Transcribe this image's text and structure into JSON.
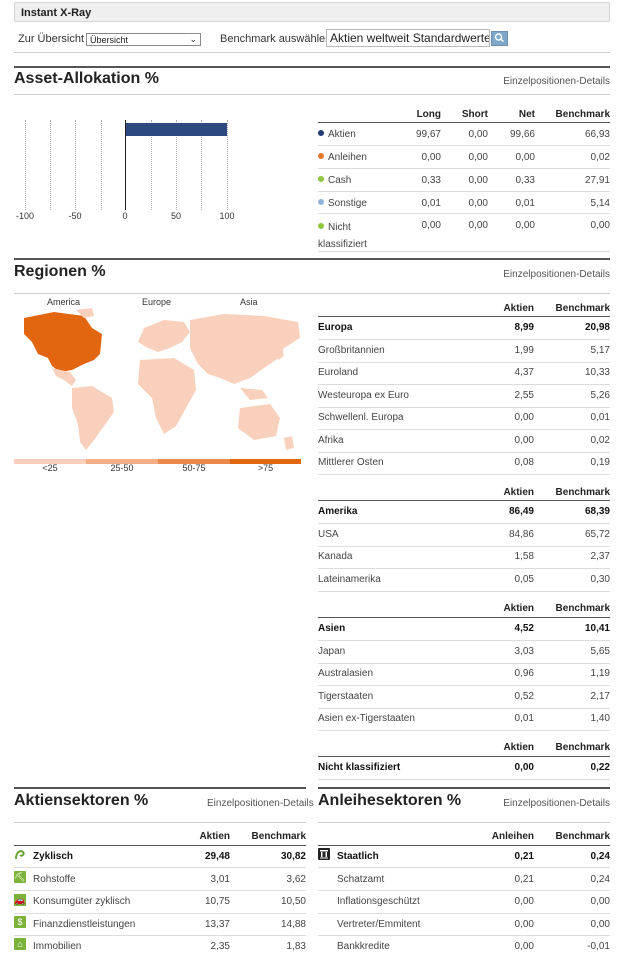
{
  "header": {
    "title": "Instant X-Ray",
    "overview_label": "Zur Übersicht",
    "overview_select": "Übersicht",
    "benchmark_label": "Benchmark auswählen",
    "benchmark_value": "Aktien weltweit Standardwerte"
  },
  "asset_allocation": {
    "title": "Asset-Allokation %",
    "details_link": "Einzelpositionen-Details",
    "headers": [
      "Long",
      "Short",
      "Net",
      "Benchmark"
    ],
    "rows": [
      {
        "label": "Aktien",
        "color": "#1f3b73",
        "long": "99,67",
        "short": "0,00",
        "net": "99,66",
        "benchmark": "66,93"
      },
      {
        "label": "Anleihen",
        "color": "#e8762b",
        "long": "0,00",
        "short": "0,00",
        "net": "0,00",
        "benchmark": "0,02"
      },
      {
        "label": "Cash",
        "color": "#8dc63f",
        "long": "0,33",
        "short": "0,00",
        "net": "0,33",
        "benchmark": "27,91"
      },
      {
        "label": "Sonstige",
        "color": "#8fb3d9",
        "long": "0,01",
        "short": "0,00",
        "net": "0,01",
        "benchmark": "5,14"
      },
      {
        "label_line1": "Nicht",
        "label_line2": "klassifiziert",
        "color": "#8dc63f",
        "long": "0,00",
        "short": "0,00",
        "net": "0,00",
        "benchmark": "0,00"
      }
    ]
  },
  "chart_data": {
    "type": "bar",
    "orientation": "horizontal",
    "categories": [
      "Aktien (Net)"
    ],
    "values": [
      99.66
    ],
    "xlim": [
      -100,
      100
    ],
    "ticks": [
      "-100",
      "-50",
      "0",
      "50",
      "100"
    ],
    "color": "#2d4a80",
    "grid": true
  },
  "regions": {
    "title": "Regionen %",
    "details_link": "Einzelpositionen-Details",
    "map_labels": [
      "America",
      "Europe",
      "Asia"
    ],
    "legend": [
      {
        "label": "<25",
        "color": "#f9d0bb"
      },
      {
        "label": "25-50",
        "color": "#f3ae86"
      },
      {
        "label": "50-75",
        "color": "#ec8a4d"
      },
      {
        "label": ">75",
        "color": "#e2650f"
      }
    ],
    "col_headers": [
      "Aktien",
      "Benchmark"
    ],
    "europe": {
      "name": "Europa",
      "aktien": "8,99",
      "benchmark": "20,98",
      "rows": [
        {
          "label": "Großbritannien",
          "aktien": "1,99",
          "benchmark": "5,17"
        },
        {
          "label": "Euroland",
          "aktien": "4,37",
          "benchmark": "10,33"
        },
        {
          "label": "Westeuropa ex Euro",
          "aktien": "2,55",
          "benchmark": "5,26"
        },
        {
          "label": "Schwellenl. Europa",
          "aktien": "0,00",
          "benchmark": "0,01"
        },
        {
          "label": "Afrika",
          "aktien": "0,00",
          "benchmark": "0,02"
        },
        {
          "label": "Mittlerer Osten",
          "aktien": "0,08",
          "benchmark": "0,19"
        }
      ]
    },
    "america": {
      "name": "Amerika",
      "aktien": "86,49",
      "benchmark": "68,39",
      "rows": [
        {
          "label": "USA",
          "aktien": "84,86",
          "benchmark": "65,72"
        },
        {
          "label": "Kanada",
          "aktien": "1,58",
          "benchmark": "2,37"
        },
        {
          "label": "Lateinamerika",
          "aktien": "0,05",
          "benchmark": "0,30"
        }
      ]
    },
    "asia": {
      "name": "Asien",
      "aktien": "4,52",
      "benchmark": "10,41",
      "rows": [
        {
          "label": "Japan",
          "aktien": "3,03",
          "benchmark": "5,65"
        },
        {
          "label": "Australasien",
          "aktien": "0,96",
          "benchmark": "1,19"
        },
        {
          "label": "Tigerstaaten",
          "aktien": "0,52",
          "benchmark": "2,17"
        },
        {
          "label": "Asien ex-Tigerstaaten",
          "aktien": "0,01",
          "benchmark": "1,40"
        }
      ]
    },
    "unclassified": {
      "name": "Nicht klassifiziert",
      "aktien": "0,00",
      "benchmark": "0,22"
    }
  },
  "equity_sectors": {
    "title": "Aktiensektoren %",
    "details_link": "Einzelpositionen-Details",
    "col_headers": [
      "Aktien",
      "Benchmark"
    ],
    "group": {
      "name": "Zyklisch",
      "aktien": "29,48",
      "benchmark": "30,82",
      "icon": "cyclical-icon"
    },
    "rows": [
      {
        "label": "Rohstoffe",
        "aktien": "3,01",
        "benchmark": "3,62",
        "icon": "materials-icon"
      },
      {
        "label": "Konsumgüter zyklisch",
        "aktien": "10,75",
        "benchmark": "10,50",
        "icon": "consumer-cyclical-icon"
      },
      {
        "label": "Finanzdienstleistungen",
        "aktien": "13,37",
        "benchmark": "14,88",
        "icon": "financial-icon"
      },
      {
        "label": "Immobilien",
        "aktien": "2,35",
        "benchmark": "1,83",
        "icon": "real-estate-icon"
      }
    ]
  },
  "bond_sectors": {
    "title": "Anleihesektoren %",
    "details_link": "Einzelpositionen-Details",
    "col_headers": [
      "Anleihen",
      "Benchmark"
    ],
    "group": {
      "name": "Staatlich",
      "aktien": "0,21",
      "benchmark": "0,24",
      "icon": "government-icon"
    },
    "rows": [
      {
        "label": "Schatzamt",
        "aktien": "0,21",
        "benchmark": "0,24"
      },
      {
        "label": "Inflationsgeschützt",
        "aktien": "0,00",
        "benchmark": "0,00"
      },
      {
        "label": "Vertreter/Emmitent",
        "aktien": "0,00",
        "benchmark": "0,00"
      },
      {
        "label": "Bankkredite",
        "aktien": "0,00",
        "benchmark": "-0,01"
      }
    ]
  }
}
